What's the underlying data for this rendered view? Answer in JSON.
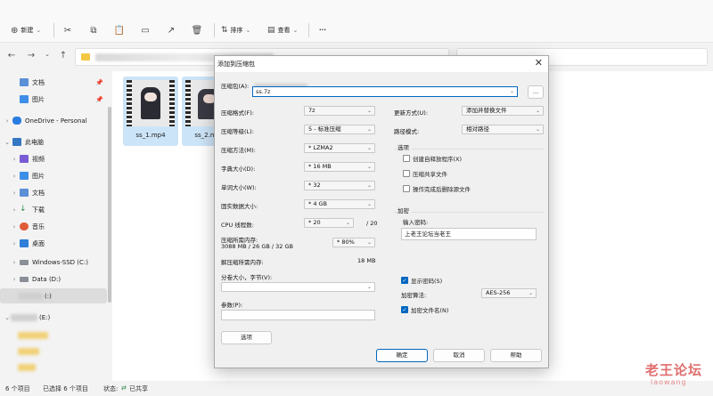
{
  "toolbar": {
    "new_label": "新建",
    "sort_label": "排序",
    "view_label": "查看",
    "more_label": "···"
  },
  "sidebar": {
    "items": [
      {
        "label": "文档",
        "icon": "document-icon"
      },
      {
        "label": "图片",
        "icon": "picture-icon"
      },
      {
        "label": "OneDrive - Personal",
        "icon": "cloud-icon"
      },
      {
        "label": "此电脑",
        "icon": "computer-icon"
      },
      {
        "label": "视频",
        "icon": "video-icon"
      },
      {
        "label": "图片",
        "icon": "picture-icon"
      },
      {
        "label": "文档",
        "icon": "document-icon"
      },
      {
        "label": "下载",
        "icon": "download-icon"
      },
      {
        "label": "音乐",
        "icon": "music-icon"
      },
      {
        "label": "桌面",
        "icon": "desktop-icon"
      },
      {
        "label": "Windows-SSD (C:)",
        "icon": "drive-icon"
      },
      {
        "label": "Data (D:)",
        "icon": "drive-icon"
      },
      {
        "label": "(:)",
        "icon": "drive-icon"
      },
      {
        "label": "(E:)",
        "icon": "drive-icon"
      }
    ]
  },
  "files": [
    {
      "name": "ss_1.mp4"
    },
    {
      "name": "ss_2.mp4"
    }
  ],
  "status": {
    "count": "6 个项目",
    "selected": "已选择 6 个项目",
    "state_label": "状态:",
    "shared": "已共享"
  },
  "dialog": {
    "title": "添加到压缩包",
    "archive_label": "压缩包(A):",
    "archive_value": "ss.7z",
    "browse": "...",
    "format_label": "压缩格式(F):",
    "format_value": "7z",
    "level_label": "压缩等级(L):",
    "level_value": "5 - 标准压缩",
    "method_label": "压缩方法(M):",
    "method_value": "* LZMA2",
    "dict_label": "字典大小(D):",
    "dict_value": "* 16 MB",
    "word_label": "单词大小(W):",
    "word_value": "* 32",
    "solid_label": "固实数据大小:",
    "solid_value": "* 4 GB",
    "threads_label": "CPU 线程数:",
    "threads_value": "* 20",
    "threads_total": "/ 20",
    "mem_label": "压缩所需内存:",
    "mem_detail": "3088 MB / 26 GB / 32 GB",
    "mem_value": "* 80%",
    "decomp_label": "解压缩所需内存:",
    "decomp_value": "18 MB",
    "split_label": "分卷大小，字节(V):",
    "params_label": "参数(P):",
    "options_btn": "选项",
    "update_label": "更新方式(U):",
    "update_value": "添加并替换文件",
    "path_label": "路径模式:",
    "path_value": "相对路径",
    "opts_group": "选项",
    "opt_sfx": "创建自释放程序(X)",
    "opt_shared": "压缩共享文件",
    "opt_delete": "操作完成后删除源文件",
    "enc_group": "加密",
    "pwd_label": "输入密码:",
    "pwd_value": "上老王论坛当老王",
    "show_pwd": "显示密码(S)",
    "enc_method_label": "加密算法:",
    "enc_method_value": "AES-256",
    "enc_names": "加密文件名(N)",
    "ok": "确定",
    "cancel": "取消",
    "help": "帮助"
  },
  "watermark": {
    "main": "老王论坛",
    "sub": "laowang"
  }
}
